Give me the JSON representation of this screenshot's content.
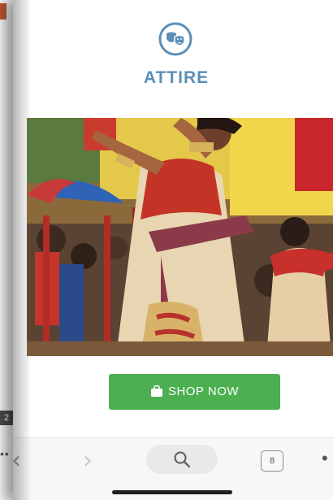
{
  "brand": {
    "name": "ATTIRE",
    "icon": "theater-masks-icon",
    "color": "#5b8fb8"
  },
  "hero": {
    "image_icon": "dancer-photo"
  },
  "cta": {
    "label": "SHOP NOW",
    "icon": "shopping-bag-icon",
    "color": "#4caf50"
  },
  "background_page": {
    "badge": "2"
  },
  "browser": {
    "back_icon": "chevron-left-icon",
    "forward_icon": "chevron-right-icon",
    "search_icon": "search-icon",
    "tab_count": "8",
    "menu_icon": "more-dots-icon"
  }
}
